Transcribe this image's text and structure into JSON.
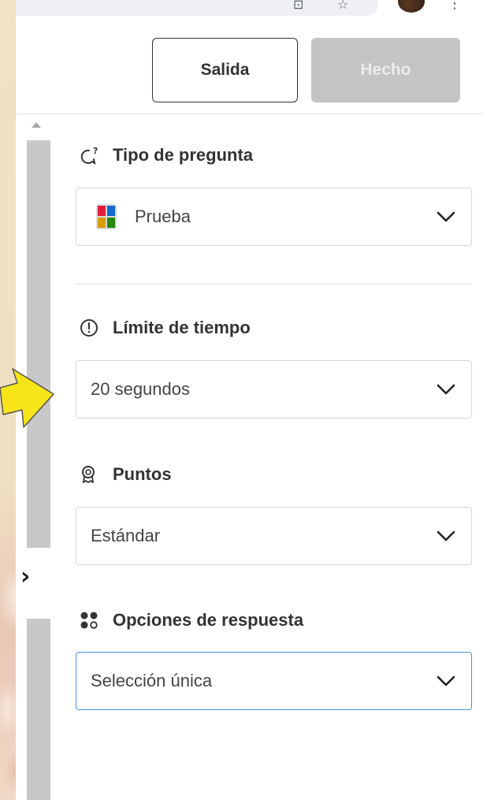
{
  "header": {
    "exit_label": "Salida",
    "done_label": "Hecho"
  },
  "sidebar": {
    "toggle_icon": "chevron-right-icon"
  },
  "settings": {
    "question_type": {
      "title": "Tipo de pregunta",
      "icon": "question-bubble-icon",
      "value": "Prueba",
      "value_icon": "quiz-tiles-icon"
    },
    "time_limit": {
      "title": "Límite de tiempo",
      "icon": "timer-icon",
      "value": "20 segundos"
    },
    "points": {
      "title": "Puntos",
      "icon": "award-icon",
      "value": "Estándar"
    },
    "answer_options": {
      "title": "Opciones de respuesta",
      "icon": "dots-grid-icon",
      "value": "Selección única"
    }
  },
  "colors": {
    "done_disabled": "#c4c4c4",
    "focus_border": "#4a90e2",
    "pointer_arrow": "#f7e51a"
  }
}
